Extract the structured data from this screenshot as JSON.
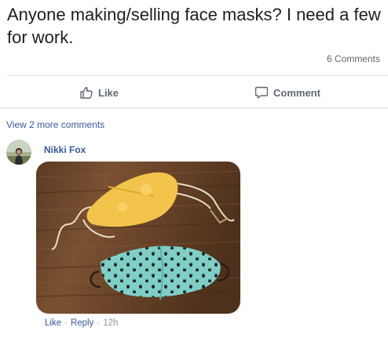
{
  "post": {
    "text": "Anyone making/selling face masks? I need a few for work.",
    "comment_count": "6 Comments"
  },
  "actions": {
    "like_label": "Like",
    "comment_label": "Comment"
  },
  "comments": {
    "view_more": "View 2 more comments",
    "items": [
      {
        "author": "Nikki Fox",
        "like_label": "Like",
        "separator": "·",
        "reply_label": "Reply",
        "time": "12h"
      }
    ]
  },
  "colors": {
    "link": "#385898",
    "muted": "#606770",
    "divider": "#dadde1"
  },
  "icons": [
    "thumbs-up-icon",
    "comment-icon"
  ]
}
